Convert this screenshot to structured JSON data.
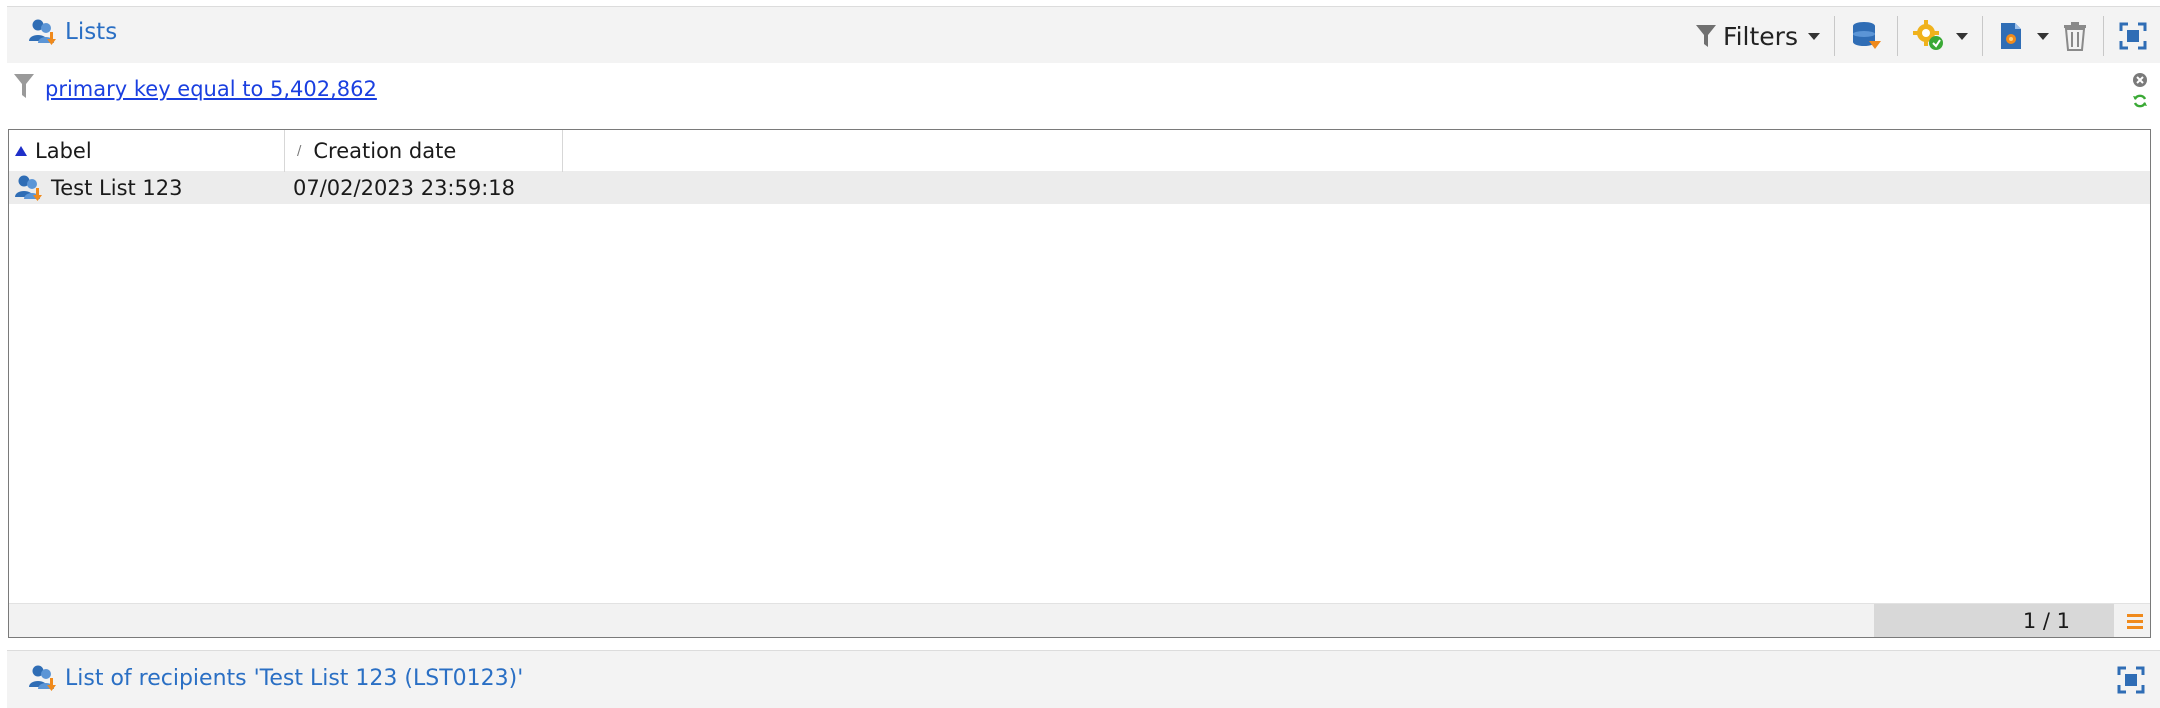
{
  "header": {
    "title": "Lists",
    "icon": "recipients-list-icon"
  },
  "toolbar": {
    "filters_label": "Filters",
    "icons": [
      "filter-icon",
      "database-icon",
      "gear-add-icon",
      "new-list-icon",
      "trash-icon",
      "fullscreen-icon"
    ]
  },
  "filter": {
    "link_text": "primary key equal to 5,402,862"
  },
  "grid": {
    "columns": [
      {
        "label": "Label",
        "sort": "ascending"
      },
      {
        "label": "Creation date",
        "sort": "none"
      }
    ],
    "rows": [
      {
        "label": "Test List 123",
        "creation_date": "07/02/2023 23:59:18"
      }
    ],
    "pager": "1 / 1"
  },
  "detail": {
    "title": "List of recipients 'Test List 123 (LST0123)'"
  },
  "colors": {
    "accent": "#2a6fc4",
    "link": "#1a3fe0",
    "orange": "#f08a1c",
    "green": "#3aa935"
  }
}
